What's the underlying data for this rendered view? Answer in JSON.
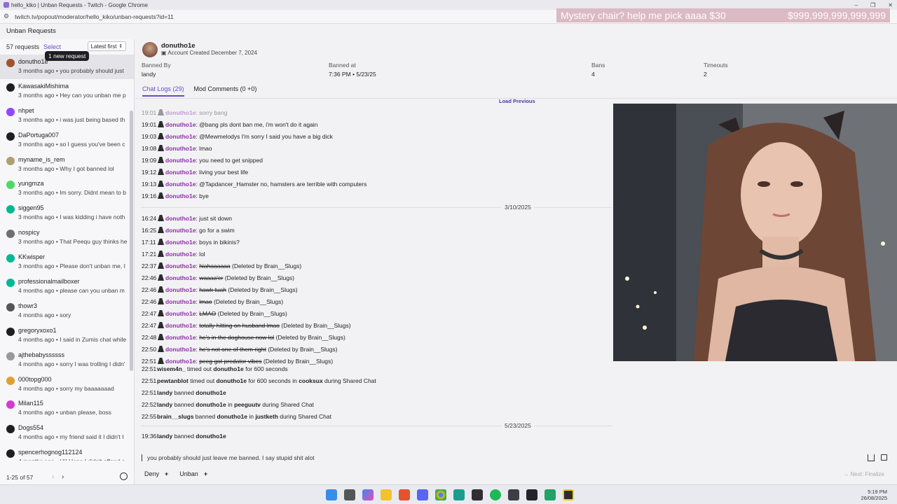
{
  "browser": {
    "window_title": "hello_kiko | Unban Requests - Twitch - Google Chrome",
    "url": "twitch.tv/popout/moderator/hello_kiko/unban-requests?id=11"
  },
  "stream_overlay": {
    "goal_text": "Mystery chair? help me pick aaaa $30",
    "goal_amount": "$999,999,999,999,999"
  },
  "header": {
    "title": "Unban Requests"
  },
  "sidebar": {
    "count": "57 requests",
    "select_label": "Select",
    "sort_label": "Latest first",
    "new_request_tooltip": "1 new request",
    "items": [
      {
        "user": "donutho1e",
        "meta": "3 months ago • you probably should just",
        "color": "#a0522d"
      },
      {
        "user": "KawasakiMishima",
        "meta": "3 months ago • Hey can you unban me p",
        "color": "#1f1f23"
      },
      {
        "user": "nhpet",
        "meta": "3 months ago • i was just being based th",
        "color": "#9146ff"
      },
      {
        "user": "DaPortuga007",
        "meta": "3 months ago • so I guess you've been c",
        "color": "#1f1f23"
      },
      {
        "user": "myname_is_rem",
        "meta": "3 months ago • Why I got banned lol",
        "color": "#b0a070"
      },
      {
        "user": "yungmza",
        "meta": "3 months ago • Im sorry. Didnt mean to b",
        "color": "#4cd964"
      },
      {
        "user": "siggen95",
        "meta": "3 months ago • I was kidding i have noth",
        "color": "#00b894"
      },
      {
        "user": "nospicy",
        "meta": "3 months ago • That Peequ guy thinks he",
        "color": "#6e6e73"
      },
      {
        "user": "KKwisper",
        "meta": "3 months ago • Please don't unban me, I",
        "color": "#00b894"
      },
      {
        "user": "professionalmailboxer",
        "meta": "4 months ago • please can you unban m",
        "color": "#00b894"
      },
      {
        "user": "thowr3",
        "meta": "4 months ago • sory",
        "color": "#555"
      },
      {
        "user": "gregoryxoxo1",
        "meta": "4 months ago • I said in Zumis chat while",
        "color": "#1f1f23"
      },
      {
        "user": "ajthebabyssssss",
        "meta": "4 months ago • sorry I was trolling I didn'",
        "color": "#999"
      },
      {
        "user": "000topg000",
        "meta": "4 months ago • sorry my baaaaaaad",
        "color": "#e0a030"
      },
      {
        "user": "Milan115",
        "meta": "4 months ago • unban please, boss",
        "color": "#d63ad6"
      },
      {
        "user": "Dogs554",
        "meta": "4 months ago • my friend said it I didn't I",
        "color": "#1f1f23"
      },
      {
        "user": "spencerhognog112124",
        "meta": "4 months ago • Hi! Hope I didn't offend o",
        "color": "#1f1f23"
      }
    ],
    "pagination": "1-25 of 57",
    "prev_icon": "‹",
    "next_icon": "›"
  },
  "detail": {
    "username": "donutho1e",
    "account_created": "Account Created December 7, 2024",
    "banned_by_label": "Banned By",
    "banned_by": "landy",
    "banned_at_label": "Banned at",
    "banned_at": "7:36 PM • 5/23/25",
    "bans_label": "Bans",
    "bans": "4",
    "timeouts_label": "Timeouts",
    "timeouts": "2",
    "tab_chat_logs": "Chat Logs (29)",
    "tab_mod_comments": "Mod Comments (0 +0)",
    "load_previous": "Load Previous"
  },
  "logs": [
    {
      "time": "19:01",
      "user": "donutho1e",
      "msg": ": sorry bang",
      "faded": true
    },
    {
      "time": "19:01",
      "user": "donutho1e",
      "msg": ": @bang pls dont ban me, i'm won't do it again"
    },
    {
      "time": "19:03",
      "user": "donutho1e",
      "msg": ": @Mewmelodys I'm sorry I said you have a big dick"
    },
    {
      "time": "19:08",
      "user": "donutho1e",
      "msg": ": lmao"
    },
    {
      "time": "19:09",
      "user": "donutho1e",
      "msg": ": you need to get snipped"
    },
    {
      "time": "19:12",
      "user": "donutho1e",
      "msg": ": living your best life"
    },
    {
      "time": "19:13",
      "user": "donutho1e",
      "msg": ": @Tapdancer_Hamster no, hamsters are terrible with computers"
    },
    {
      "time": "19:16",
      "user": "donutho1e",
      "msg": ": bye"
    },
    {
      "time": "16:24",
      "user": "donutho1e",
      "msg": ": just sit down"
    },
    {
      "time": "16:25",
      "user": "donutho1e",
      "msg": ": go for a swim"
    },
    {
      "time": "17:11",
      "user": "donutho1e",
      "msg": ": boys in bikinis?"
    },
    {
      "time": "17:21",
      "user": "donutho1e",
      "msg": ": lol"
    },
    {
      "time": "22:37",
      "user": "donutho1e",
      "deleted": "hiahaaaaaa",
      "note": " (Deleted by Brain__Slugs)"
    },
    {
      "time": "22:46",
      "user": "donutho1e",
      "deleted": "waaaa'er",
      "note": " (Deleted by Brain__Slugs)"
    },
    {
      "time": "22:46",
      "user": "donutho1e",
      "deleted": "hawk tuah",
      "note": " (Deleted by Brain__Slugs)"
    },
    {
      "time": "22:46",
      "user": "donutho1e",
      "deleted": "lmao",
      "note": " (Deleted by Brain__Slugs)"
    },
    {
      "time": "22:47",
      "user": "donutho1e",
      "deleted": "LMAO",
      "note": " (Deleted by Brain__Slugs)"
    },
    {
      "time": "22:47",
      "user": "donutho1e",
      "deleted": "totally hitting on husband lmao",
      "note": " (Deleted by Brain__Slugs)"
    },
    {
      "time": "22:48",
      "user": "donutho1e",
      "deleted": "he's in the doghouse now lol",
      "note": " (Deleted by Brain__Slugs)"
    },
    {
      "time": "22:50",
      "user": "donutho1e",
      "deleted": "he's not one of them right",
      "note": " (Deleted by Brain__Slugs)"
    },
    {
      "time": "22:51",
      "user": "donutho1e",
      "deleted": "peeg got predator vibes",
      "note": " (Deleted by Brain__Slugs)"
    }
  ],
  "date_1": "3/10/2025",
  "date_2": "5/23/2025",
  "mod_events": {
    "e1_time": "22:51",
    "e1_mod": "wisem4n_",
    "e1_action": " timed out ",
    "e1_user": "donutho1e",
    "e1_rest": " for 600 seconds",
    "e2_time": "22:51",
    "e2_mod": "pewtanblot",
    "e2_action": " timed out ",
    "e2_user": "donutho1e",
    "e2_mid": " for 600 seconds in ",
    "e2_channel": "cooksux",
    "e2_rest": " during Shared Chat",
    "e3_time": "22:51",
    "e3_mod": "landy",
    "e3_action": " banned ",
    "e3_user": "donutho1e",
    "e4_time": "22:52",
    "e4_mod": "landy",
    "e4_action": " banned ",
    "e4_user": "donutho1e",
    "e4_mid": " in ",
    "e4_channel": "peeguutv",
    "e4_rest": " during Shared Chat",
    "e5_time": "22:55",
    "e5_mod": "brain__slugs",
    "e5_action": " banned ",
    "e5_user": "donutho1e",
    "e5_mid": " in ",
    "e5_channel": "justketh",
    "e5_rest": " during Shared Chat",
    "e6_time": "19:36",
    "e6_mod": "landy",
    "e6_action": " banned ",
    "e6_user": "donutho1e"
  },
  "reply": {
    "text": "you probably should just leave me banned. I say stupid shit alot"
  },
  "actions": {
    "deny": "Deny",
    "unban": "Unban",
    "plus": "+",
    "next_finalize": "Next: Finalize"
  },
  "clock": {
    "time": "5:19 PM",
    "date": "26/08/2025"
  }
}
